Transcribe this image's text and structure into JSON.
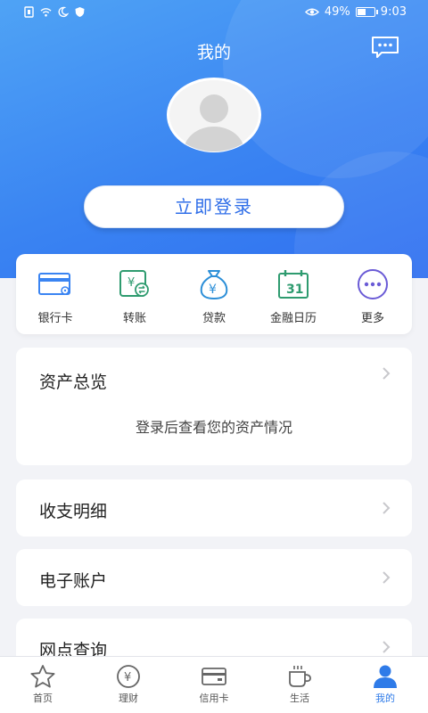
{
  "status_bar": {
    "battery_percent": "49%",
    "time": "9:03"
  },
  "header": {
    "title": "我的",
    "message_icon": "chat-bubble-icon"
  },
  "login": {
    "button_label": "立即登录"
  },
  "shortcuts": [
    {
      "label": "银行卡",
      "icon": "bank-card-icon"
    },
    {
      "label": "转账",
      "icon": "transfer-icon"
    },
    {
      "label": "贷款",
      "icon": "loan-bag-icon"
    },
    {
      "label": "金融日历",
      "icon": "calendar-icon"
    },
    {
      "label": "更多",
      "icon": "more-icon"
    }
  ],
  "asset_overview": {
    "title": "资产总览",
    "hint": "登录后查看您的资产情况"
  },
  "menu_rows": [
    {
      "label": "收支明细"
    },
    {
      "label": "电子账户"
    },
    {
      "label": "网点查询"
    }
  ],
  "tabbar": [
    {
      "label": "首页",
      "icon": "star-icon"
    },
    {
      "label": "理财",
      "icon": "yuan-coin-icon"
    },
    {
      "label": "信用卡",
      "icon": "credit-card-icon"
    },
    {
      "label": "生活",
      "icon": "coffee-cup-icon"
    },
    {
      "label": "我的",
      "icon": "person-icon",
      "active": true
    }
  ],
  "colors": {
    "brand_blue": "#3a84f2",
    "accent_green": "#2e9b6f",
    "accent_purple": "#6a5bd6",
    "active_tab": "#2f7be8"
  }
}
